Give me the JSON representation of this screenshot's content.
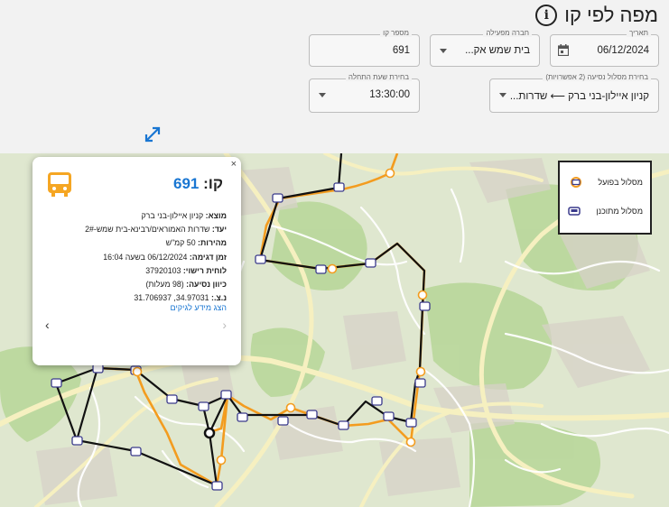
{
  "page": {
    "title": "מפה לפי קו"
  },
  "filters": {
    "date": {
      "label": "תאריך",
      "value": "06/12/2024"
    },
    "operator": {
      "label": "חברה מפעילה",
      "value": "בית שמש אק..."
    },
    "line_number": {
      "label": "מספר קו",
      "value": "691"
    },
    "route": {
      "label": "בחירת מסלול נסיעה (2 אפשרויות)",
      "value": "קניון איילון-בני ברק ⟵ שדרות..."
    },
    "start_time": {
      "label": "בחירת שעת התחלה",
      "value": "13:30:00"
    }
  },
  "legend": {
    "actual": "מסלול בפועל",
    "planned": "מסלול מתוכנן"
  },
  "popup": {
    "line_label": "קו:",
    "line_number": "691",
    "rows": [
      {
        "key": "מוצא:",
        "value": "קניון איילון-בני ברק"
      },
      {
        "key": "יעד:",
        "value": "שדרות האמוראים/רבינא-בית שמש-2#"
      },
      {
        "key": "מהירות:",
        "value": "50 קמ\"ש"
      },
      {
        "key": "זמן דגימה:",
        "value": "06/12/2024 בשעה 16:04"
      },
      {
        "key": "לוחית רישוי:",
        "value": "37920103"
      },
      {
        "key": "כיוון נסיעה:",
        "value": "(98 מעלות)"
      },
      {
        "key": "נ.צ.:",
        "value": "34.97031, 31.706937"
      }
    ],
    "more_info": "הצג מידע לגיקים",
    "close": "×",
    "prev": "‹",
    "next": "›"
  },
  "colors": {
    "accent": "#1976d2",
    "actual_route": "#f39c1f",
    "planned_route": "#111111",
    "bus_icon": "#f5a623"
  },
  "icons": {
    "info": "info-icon",
    "calendar": "calendar-icon",
    "expand": "expand-icon",
    "bus": "bus-icon"
  }
}
